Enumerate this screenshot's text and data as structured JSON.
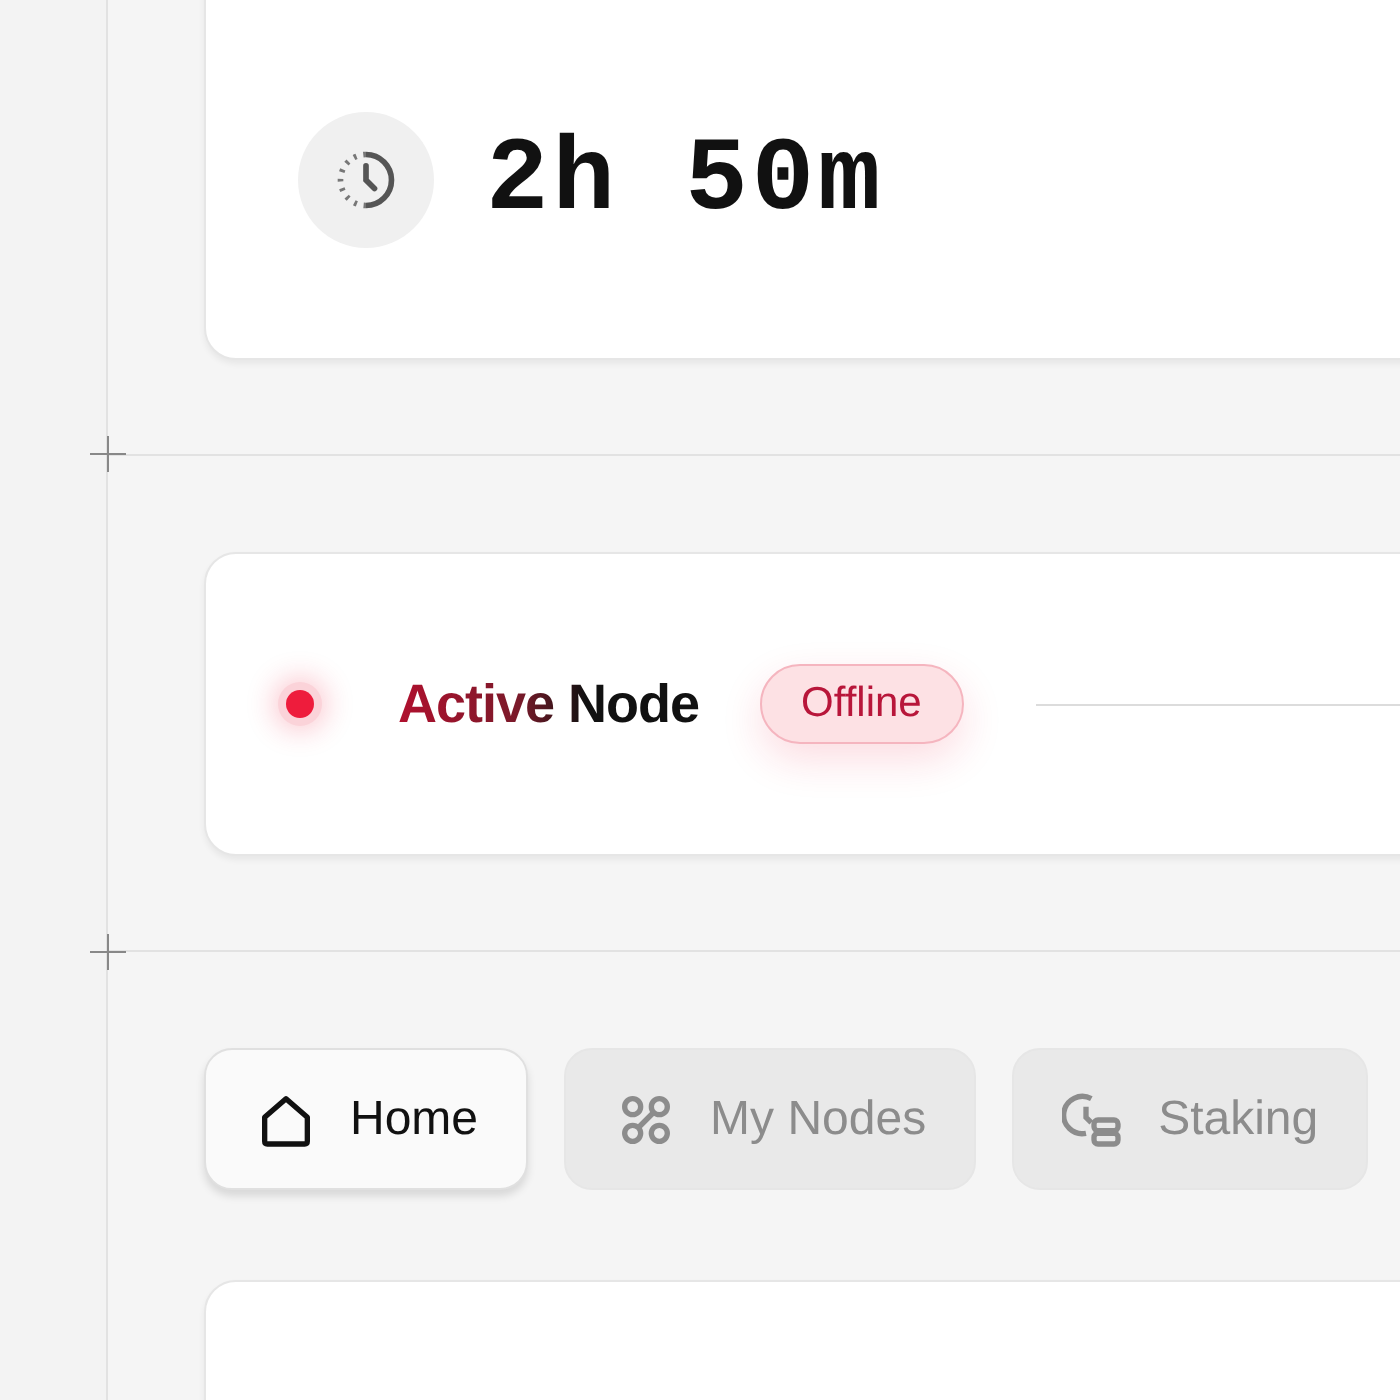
{
  "timer": {
    "value": "2h 50m"
  },
  "node": {
    "title": "Active Node",
    "color": "#ee1c3c",
    "badge": "Offline"
  },
  "tabs": [
    {
      "label": "Home",
      "selected": true
    },
    {
      "label": "My Nodes",
      "selected": false
    },
    {
      "label": "Staking",
      "selected": false
    }
  ]
}
